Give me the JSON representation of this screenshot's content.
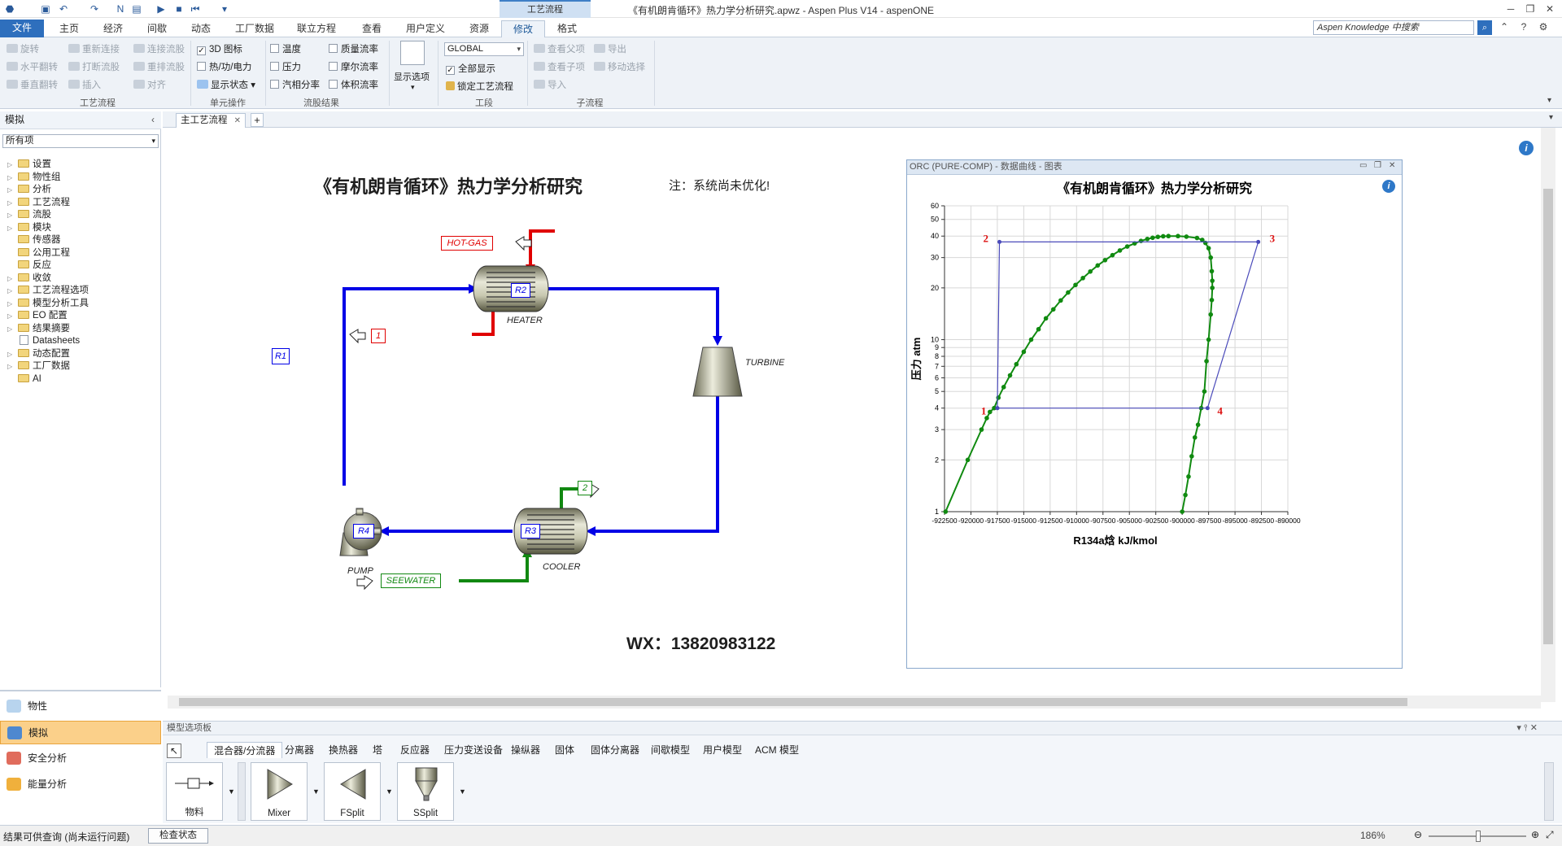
{
  "window": {
    "title": "《有机朗肯循环》热力学分析研究.apwz - Aspen Plus V14 - aspenONE",
    "context_tab": "工艺流程"
  },
  "ribbon_tabs": [
    "文件",
    "主页",
    "经济",
    "间歇",
    "动态",
    "工厂数据",
    "联立方程",
    "查看",
    "用户定义",
    "资源",
    "修改",
    "格式"
  ],
  "search": {
    "placeholder": "Aspen Knowledge 中搜索"
  },
  "ribbon": {
    "flowsheet_group": {
      "label": "工艺流程",
      "items": [
        "旋转",
        "水平翻转",
        "垂直翻转",
        "重新连接",
        "打断流股",
        "插入",
        "连接流股",
        "重排流股",
        "对齐"
      ]
    },
    "unit_ops_group": {
      "label": "单元操作",
      "items": [
        "3D 图标",
        "热/功/电力",
        "显示状态"
      ]
    },
    "stream_results_group": {
      "label": "流股结果",
      "items": [
        "温度",
        "压力",
        "汽相分率",
        "质量流率",
        "摩尔流率",
        "体积流率"
      ]
    },
    "display_options": {
      "label": "显示选项"
    },
    "section_group": {
      "label": "工段",
      "select_value": "GLOBAL",
      "items": [
        "全部显示",
        "锁定工艺流程"
      ]
    },
    "subflowsheet_group": {
      "label": "子流程",
      "items": [
        "查看父项",
        "查看子项",
        "导入",
        "导出",
        "移动选择"
      ]
    }
  },
  "left_pane": {
    "header": "模拟",
    "filter": "所有项",
    "tree": [
      "设置",
      "物性组",
      "分析",
      "工艺流程",
      "流股",
      "模块",
      "传感器",
      "公用工程",
      "反应",
      "收敛",
      "工艺流程选项",
      "模型分析工具",
      "EO 配置",
      "结果摘要",
      "Datasheets",
      "动态配置",
      "工厂数据",
      "AI"
    ],
    "nav": [
      "物性",
      "模拟",
      "安全分析",
      "能量分析"
    ]
  },
  "document_tab": "主工艺流程",
  "flowsheet": {
    "title": "《有机朗肯循环》热力学分析研究",
    "note": "注：系统尚未优化!",
    "contact": "WX：13820983122",
    "blocks": {
      "heater": "HEATER",
      "turbine": "TURBINE",
      "cooler": "COOLER",
      "pump": "PUMP"
    },
    "streams": {
      "r1": "R1",
      "r2": "R2",
      "r3": "R3",
      "r4": "R4",
      "hot_gas": "HOT-GAS",
      "s1": "1",
      "s2": "2",
      "seewater": "SEEWATER"
    }
  },
  "plot": {
    "window_title": "ORC (PURE-COMP) - 数据曲线 - 图表",
    "point_labels": [
      "1",
      "2",
      "3",
      "4"
    ]
  },
  "chart_data": {
    "type": "line",
    "title": "《有机朗肯循环》热力学分析研究",
    "xlabel": "R134a焓    kJ/kmol",
    "ylabel": "压力    atm",
    "xlim": [
      -922500,
      -890000
    ],
    "ylim": [
      1,
      60
    ],
    "y_scale": "log",
    "grid": true,
    "x_ticks": [
      -922500,
      -920000,
      -917500,
      -915000,
      -912500,
      -910000,
      -907500,
      -905000,
      -902500,
      -900000,
      -897500,
      -895000,
      -892500,
      -890000
    ],
    "y_ticks": [
      1,
      2,
      3,
      4,
      5,
      6,
      7,
      8,
      9,
      10,
      20,
      30,
      40,
      50,
      60
    ],
    "series": [
      {
        "color": "#108a10",
        "marker": "circle",
        "x": [
          -922400,
          -920300,
          -919000,
          -918500,
          -918200,
          -917800,
          -917400,
          -916900,
          -916300,
          -915700,
          -915000,
          -914300,
          -913600,
          -912900,
          -912200,
          -911500,
          -910800,
          -910100,
          -909400,
          -908700,
          -908000,
          -907300,
          -906600,
          -905900,
          -905200,
          -904500,
          -903900,
          -903300,
          -902800,
          -902300,
          -901800,
          -901300,
          -900400,
          -899600,
          -898600,
          -898100,
          -897800,
          -897500,
          -897300,
          -897200,
          -897150,
          -897150,
          -897200,
          -897300,
          -897500,
          -897700,
          -897900,
          -898200,
          -898500,
          -898800,
          -899100,
          -899400,
          -899700,
          -900000
        ],
        "y": [
          1,
          2,
          3,
          3.5,
          3.8,
          4,
          4.6,
          5.3,
          6.2,
          7.2,
          8.5,
          10,
          11.5,
          13.3,
          15,
          16.9,
          18.8,
          20.8,
          22.8,
          24.9,
          27,
          29,
          31,
          33,
          34.8,
          36.3,
          37.5,
          38.5,
          39.1,
          39.6,
          39.9,
          40,
          40,
          39.7,
          39,
          38,
          36.5,
          34,
          30,
          25,
          22,
          20,
          17,
          14,
          10,
          7.5,
          5,
          4,
          3.2,
          2.7,
          2.1,
          1.6,
          1.25,
          1
        ]
      },
      {
        "color": "#4a4aba",
        "marker": "circle",
        "x": [
          -917500,
          -917300,
          -892800,
          -897600,
          -917500
        ],
        "y": [
          4,
          37,
          37,
          4,
          4
        ]
      }
    ]
  }
}
